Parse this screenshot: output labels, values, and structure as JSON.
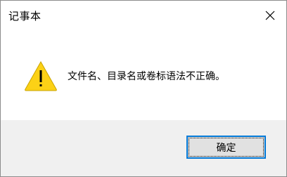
{
  "window": {
    "title": "记事本"
  },
  "dialog": {
    "message": "文件名、目录名或卷标语法不正确。",
    "icon": "warning-icon"
  },
  "buttons": {
    "ok_label": "确定",
    "close_icon": "close-icon"
  },
  "colors": {
    "warning_fill": "#fcd116",
    "focus_border": "#0078d7",
    "footer_bg": "#f0f0f0",
    "button_bg": "#e1e1e1"
  }
}
